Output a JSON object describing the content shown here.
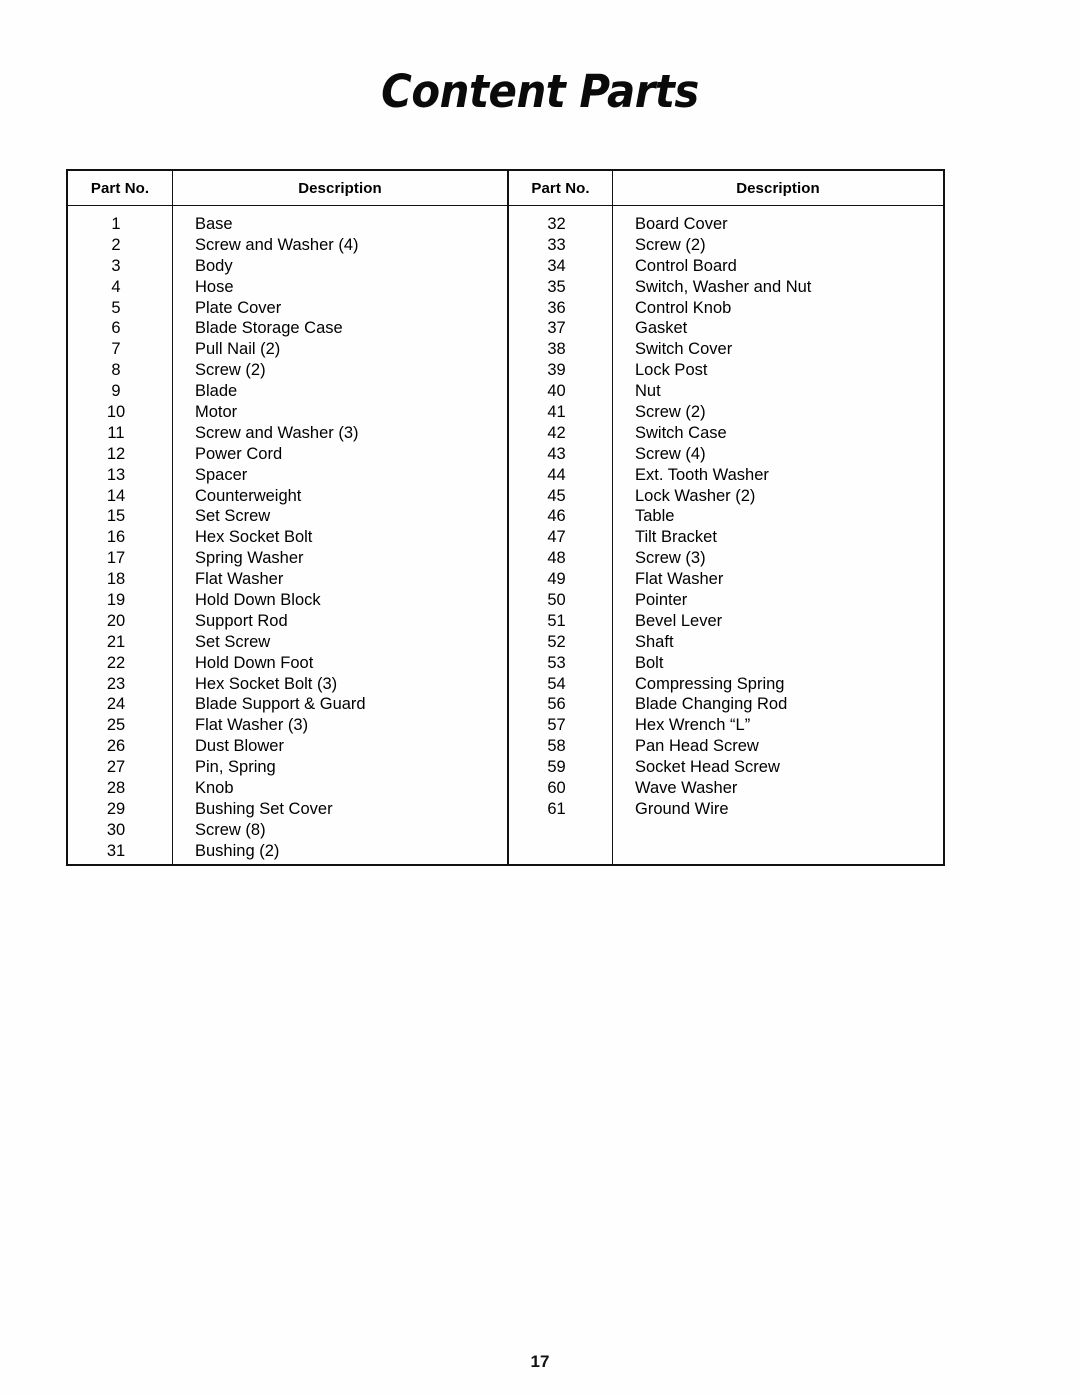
{
  "document": {
    "title": "Content Parts",
    "page_number": "17"
  },
  "table": {
    "headers": {
      "part_no": "Part No.",
      "description": "Description"
    },
    "left_column": [
      {
        "part_no": "1",
        "description": "Base"
      },
      {
        "part_no": "2",
        "description": "Screw and Washer (4)"
      },
      {
        "part_no": "3",
        "description": "Body"
      },
      {
        "part_no": "4",
        "description": "Hose"
      },
      {
        "part_no": "5",
        "description": "Plate Cover"
      },
      {
        "part_no": "6",
        "description": "Blade Storage Case"
      },
      {
        "part_no": "7",
        "description": "Pull Nail (2)"
      },
      {
        "part_no": "8",
        "description": "Screw (2)"
      },
      {
        "part_no": "9",
        "description": "Blade"
      },
      {
        "part_no": "10",
        "description": "Motor"
      },
      {
        "part_no": "11",
        "description": "Screw and Washer (3)"
      },
      {
        "part_no": "12",
        "description": "Power Cord"
      },
      {
        "part_no": "13",
        "description": "Spacer"
      },
      {
        "part_no": "14",
        "description": "Counterweight"
      },
      {
        "part_no": "15",
        "description": "Set Screw"
      },
      {
        "part_no": "16",
        "description": "Hex Socket Bolt"
      },
      {
        "part_no": "17",
        "description": "Spring Washer"
      },
      {
        "part_no": "18",
        "description": "Flat Washer"
      },
      {
        "part_no": "19",
        "description": "Hold Down Block"
      },
      {
        "part_no": "20",
        "description": "Support Rod"
      },
      {
        "part_no": "21",
        "description": "Set Screw"
      },
      {
        "part_no": "22",
        "description": "Hold Down Foot"
      },
      {
        "part_no": "23",
        "description": "Hex Socket Bolt (3)"
      },
      {
        "part_no": "24",
        "description": "Blade Support & Guard"
      },
      {
        "part_no": "25",
        "description": "Flat Washer (3)"
      },
      {
        "part_no": "26",
        "description": "Dust Blower"
      },
      {
        "part_no": "27",
        "description": "Pin, Spring"
      },
      {
        "part_no": "28",
        "description": "Knob"
      },
      {
        "part_no": "29",
        "description": "Bushing Set Cover"
      },
      {
        "part_no": "30",
        "description": "Screw (8)"
      },
      {
        "part_no": "31",
        "description": "Bushing (2)"
      }
    ],
    "right_column": [
      {
        "part_no": "32",
        "description": "Board Cover"
      },
      {
        "part_no": "33",
        "description": "Screw (2)"
      },
      {
        "part_no": "34",
        "description": "Control Board"
      },
      {
        "part_no": "35",
        "description": "Switch, Washer and Nut"
      },
      {
        "part_no": "36",
        "description": "Control Knob"
      },
      {
        "part_no": "37",
        "description": "Gasket"
      },
      {
        "part_no": "38",
        "description": "Switch Cover"
      },
      {
        "part_no": "39",
        "description": "Lock Post"
      },
      {
        "part_no": "40",
        "description": "Nut"
      },
      {
        "part_no": "41",
        "description": "Screw (2)"
      },
      {
        "part_no": "42",
        "description": "Switch Case"
      },
      {
        "part_no": "43",
        "description": "Screw (4)"
      },
      {
        "part_no": "44",
        "description": "Ext. Tooth Washer"
      },
      {
        "part_no": "45",
        "description": "Lock Washer (2)"
      },
      {
        "part_no": "46",
        "description": "Table"
      },
      {
        "part_no": "47",
        "description": "Tilt Bracket"
      },
      {
        "part_no": "48",
        "description": "Screw (3)"
      },
      {
        "part_no": "49",
        "description": "Flat Washer"
      },
      {
        "part_no": "50",
        "description": "Pointer"
      },
      {
        "part_no": "51",
        "description": "Bevel Lever"
      },
      {
        "part_no": "52",
        "description": "Shaft"
      },
      {
        "part_no": "53",
        "description": "Bolt"
      },
      {
        "part_no": "54",
        "description": "Compressing Spring"
      },
      {
        "part_no": "56",
        "description": "Blade Changing Rod"
      },
      {
        "part_no": "57",
        "description": "Hex Wrench “L”"
      },
      {
        "part_no": "58",
        "description": "Pan Head Screw"
      },
      {
        "part_no": "59",
        "description": "Socket Head Screw"
      },
      {
        "part_no": "60",
        "description": "Wave Washer"
      },
      {
        "part_no": "61",
        "description": "Ground Wire"
      }
    ]
  }
}
